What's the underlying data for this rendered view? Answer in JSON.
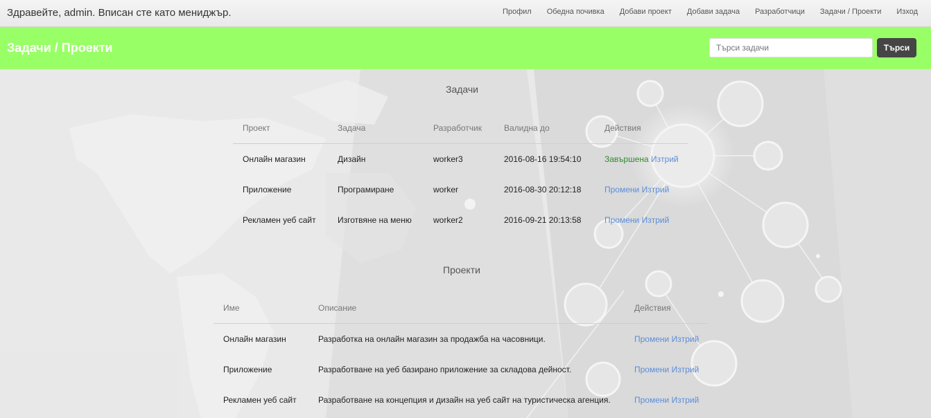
{
  "topbar": {
    "greeting": "Здравейте, admin. Вписан сте като мениджър.",
    "nav": [
      "Профил",
      "Обедна почивка",
      "Добави проект",
      "Добави задача",
      "Разработчици",
      "Задачи / Проекти",
      "Изход"
    ]
  },
  "header": {
    "title": "Задачи / Проекти",
    "search_placeholder": "Търси задачи",
    "search_button": "Търси",
    "color": "#99ff66"
  },
  "tasks": {
    "title": "Задачи",
    "columns": [
      "Проект",
      "Задача",
      "Разработчик",
      "Валидна до",
      "Действия"
    ],
    "rows": [
      {
        "project": "Онлайн магазин",
        "task": "Дизайн",
        "developer": "worker3",
        "valid_until": "2016-08-16 19:54:10",
        "status": "Завършена",
        "edit": "",
        "delete": "Изтрий"
      },
      {
        "project": "Приложение",
        "task": "Програмиране",
        "developer": "worker",
        "valid_until": "2016-08-30 20:12:18",
        "status": "",
        "edit": "Промени",
        "delete": "Изтрий"
      },
      {
        "project": "Рекламен уеб сайт",
        "task": "Изготвяне на меню",
        "developer": "worker2",
        "valid_until": "2016-09-21 20:13:58",
        "status": "",
        "edit": "Промени",
        "delete": "Изтрий"
      }
    ]
  },
  "projects": {
    "title": "Проекти",
    "columns": [
      "Име",
      "Описание",
      "Действия"
    ],
    "rows": [
      {
        "name": "Онлайн магазин",
        "description": "Разработка на онлайн магазин за продажба на часовници.",
        "edit": "Промени",
        "delete": "Изтрий"
      },
      {
        "name": "Приложение",
        "description": "Разработване на уеб базирано приложение за складова дейност.",
        "edit": "Промени",
        "delete": "Изтрий"
      },
      {
        "name": "Рекламен уеб сайт",
        "description": "Разработване на концепция и дизайн на уеб сайт на туристическа агенция.",
        "edit": "Промени",
        "delete": "Изтрий"
      }
    ]
  },
  "colors": {
    "link": "#5b8dd9",
    "done": "#2e8b2e",
    "search_button": "#454545"
  }
}
